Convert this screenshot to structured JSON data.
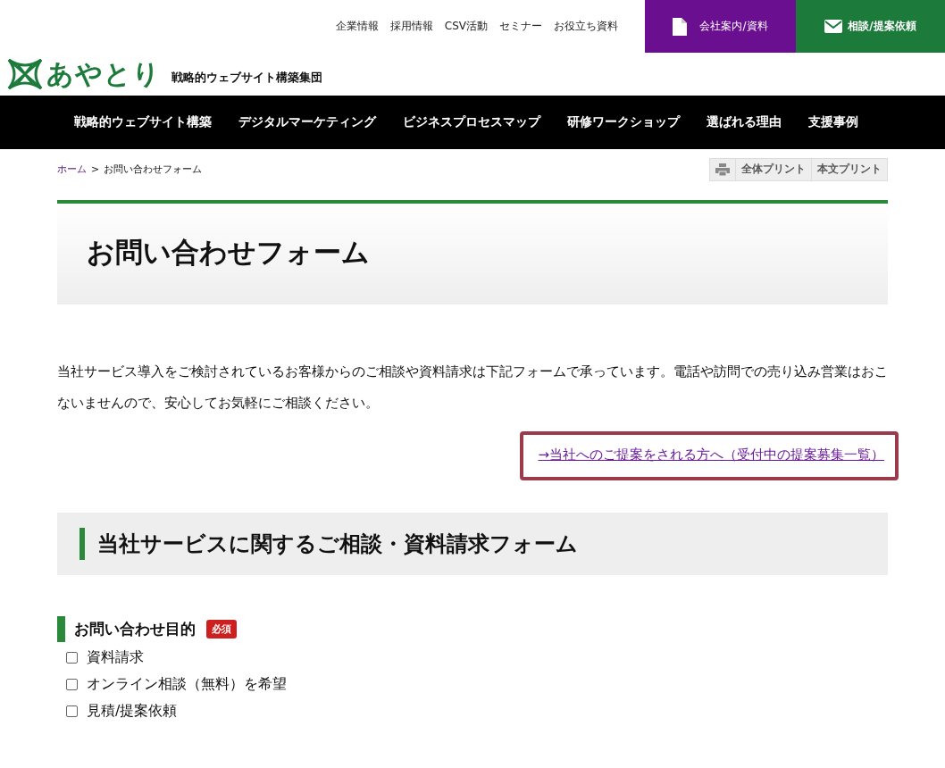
{
  "top_links": [
    "企業情報",
    "採用情報",
    "CSV活動",
    "セミナー",
    "お役立ち資料"
  ],
  "top_buttons": [
    {
      "label": "会社案内/資料",
      "kind": "document"
    },
    {
      "label": "相談/提案依頼",
      "kind": "mail"
    }
  ],
  "logo": {
    "name": "あやとり",
    "tagline": "戦略的ウェブサイト構築集団"
  },
  "nav": [
    "戦略的ウェブサイト構築",
    "デジタルマーケティング",
    "ビジネスプロセスマップ",
    "研修ワークショップ",
    "選ばれる理由",
    "支援事例"
  ],
  "breadcrumb": {
    "home": "ホーム",
    "separator": ">",
    "current": "お問い合わせフォーム"
  },
  "print_buttons": [
    "全体プリント",
    "本文プリント"
  ],
  "page_title": "お問い合わせフォーム",
  "intro": "当社サービス導入をご検討されているお客様からのご相談や資料請求は下記フォームで承っています。電話や訪問での売り込み営業はおこないませんので、安心してお気軽にご相談ください。",
  "proposal_link": "→当社へのご提案をされる方へ（受付中の提案募集一覧）",
  "form_title": "当社サービスに関するご相談・資料請求フォーム",
  "field": {
    "label": "お問い合わせ目的",
    "required": true,
    "required_label": "必須",
    "options": [
      {
        "label": "資料請求",
        "checked": false
      },
      {
        "label": "オンライン相談（無料）を希望",
        "checked": false
      },
      {
        "label": "見積/提案依頼",
        "checked": false
      }
    ]
  }
}
